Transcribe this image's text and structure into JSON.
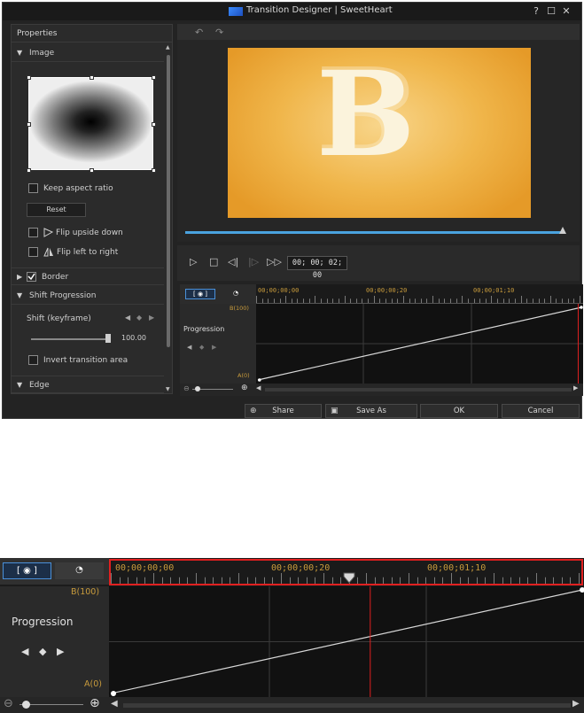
{
  "window": {
    "title": "Transition Designer | SweetHeart",
    "help_glyph": "?",
    "max_glyph": "☐",
    "close_glyph": "✕"
  },
  "properties": {
    "header": "Properties",
    "image_section": "Image",
    "keep_aspect": "Keep aspect ratio",
    "reset": "Reset",
    "flip_upside": "Flip upside down",
    "flip_left": "Flip left to right",
    "border_section": "Border",
    "shift_section": "Shift Progression",
    "shift_keyframe": "Shift (keyframe)",
    "shift_value": "100.00",
    "invert": "Invert transition area",
    "edge_section": "Edge"
  },
  "preview": {
    "letter": "B",
    "progress_fraction": 1.0
  },
  "transport": {
    "timecode": "00; 00; 02; 00"
  },
  "timeline": {
    "ticks": [
      "00;00;00;00",
      "00;00;00;20",
      "00;00;01;10"
    ],
    "track_label": "Progression",
    "top_value": "B(100)",
    "bottom_value": "A(0)",
    "playhead_fraction": 0.55
  },
  "buttons": {
    "share": "Share",
    "save_as": "Save As",
    "ok": "OK",
    "cancel": "Cancel"
  },
  "colors": {
    "accent": "#4aa3df",
    "timecode": "#c89b3c",
    "playhead": "#e02020"
  }
}
